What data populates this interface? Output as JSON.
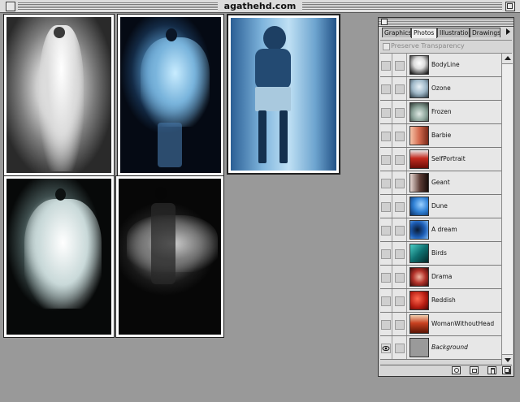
{
  "window": {
    "title": "agathehd.com"
  },
  "palette": {
    "tabs": [
      {
        "label": "Graphics",
        "active": false
      },
      {
        "label": "Photos",
        "active": true
      },
      {
        "label": "Illustrations",
        "active": false
      },
      {
        "label": "Drawings",
        "active": false
      }
    ],
    "preserve_transparency": "Preserve Transparency",
    "layers": [
      {
        "label": "BodyLine",
        "thumb": "#f2f2f2"
      },
      {
        "label": "Ozone",
        "thumb": "#9fb8c8"
      },
      {
        "label": "Frozen",
        "thumb": "#8da59b"
      },
      {
        "label": "Barbie",
        "thumb": "#d36a4e"
      },
      {
        "label": "SelfPortrait",
        "thumb": "#c42a1e"
      },
      {
        "label": "Geant",
        "thumb": "#5a3a33"
      },
      {
        "label": "Dune",
        "thumb": "#2e7fd4"
      },
      {
        "label": "A dream",
        "thumb": "#1d5fb8"
      },
      {
        "label": "Birds",
        "thumb": "#0f7070"
      },
      {
        "label": "Drama",
        "thumb": "#b3322a"
      },
      {
        "label": "Reddish",
        "thumb": "#b81d12"
      },
      {
        "label": "WomanWithoutHead",
        "thumb": "#c9401f"
      },
      {
        "label": "Background",
        "thumb": "#9a9a9a"
      }
    ]
  },
  "photos": [
    {
      "name": "ghost-white",
      "tone": "#d8d8d8"
    },
    {
      "name": "ghost-blue",
      "tone": "#4f8fc4"
    },
    {
      "name": "woman-standing-blue",
      "tone": "#9fcce8"
    },
    {
      "name": "ghost-cyan",
      "tone": "#b9cfcf"
    },
    {
      "name": "ghost-grey",
      "tone": "#7a7a7a"
    }
  ]
}
